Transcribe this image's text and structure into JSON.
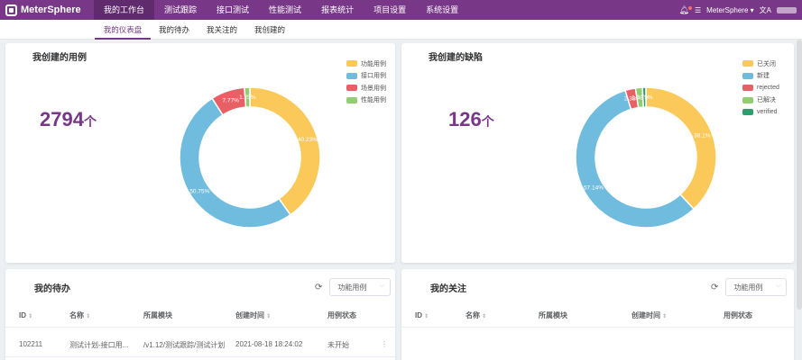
{
  "app": {
    "logo_text": "MeterSphere"
  },
  "nav": {
    "items": [
      "我的工作台",
      "测试跟踪",
      "接口测试",
      "性能测试",
      "报表统计",
      "项目设置",
      "系统设置"
    ],
    "active_index": 0
  },
  "header_right": {
    "workspace": "MeterSphere",
    "lang": "文A"
  },
  "subnav": {
    "items": [
      "我的仪表盘",
      "我的待办",
      "我关注的",
      "我创建的"
    ],
    "active_index": 0
  },
  "cases_card": {
    "title": "我创建的用例",
    "count": "2794",
    "unit": "个",
    "legend": [
      "功能用例",
      "接口用例",
      "场景用例",
      "性能用例"
    ]
  },
  "bugs_card": {
    "title": "我创建的缺陷",
    "count": "126",
    "unit": "个",
    "legend": [
      "已关闭",
      "新建",
      "rejected",
      "已解决",
      "verified"
    ]
  },
  "chart_data": [
    {
      "type": "pie",
      "categories": [
        "功能用例",
        "接口用例",
        "场景用例",
        "性能用例"
      ],
      "values": [
        40.23,
        50.75,
        7.77,
        1.25
      ],
      "labels": [
        "40.23%",
        "50.75%",
        "7.77%",
        "1.25%"
      ],
      "colors": [
        "#fbc95a",
        "#70bcde",
        "#e86065",
        "#92ce71"
      ],
      "legend_position": "top-right"
    },
    {
      "type": "pie",
      "categories": [
        "已关闭",
        "新建",
        "rejected",
        "已解决",
        "verified"
      ],
      "values": [
        38.1,
        57.14,
        2.38,
        1.59,
        0.79
      ],
      "labels": [
        "38.1%",
        "57.14%",
        "2.38%",
        "1.59%",
        "0.79%"
      ],
      "colors": [
        "#fbc95a",
        "#70bcde",
        "#e86065",
        "#92ce71",
        "#2f9e6e"
      ],
      "legend_position": "top-right"
    }
  ],
  "todo_card": {
    "title": "我的待办",
    "filter": "功能用例",
    "columns": [
      "ID",
      "名称",
      "所属模块",
      "创建时间",
      "用例状态"
    ],
    "rows": [
      {
        "id": "102211",
        "name": "测试计划-接口用...",
        "module": "/v1.12/测试跟踪/测试计划",
        "created": "2021-08-18 18:24:02",
        "status": "未开始"
      }
    ]
  },
  "follow_card": {
    "title": "我的关注",
    "filter": "功能用例",
    "columns": [
      "ID",
      "名称",
      "所属模块",
      "创建时间",
      "用例状态"
    ]
  },
  "colors": {
    "brand": "#783887",
    "nav_active": "#5f2b6c"
  }
}
